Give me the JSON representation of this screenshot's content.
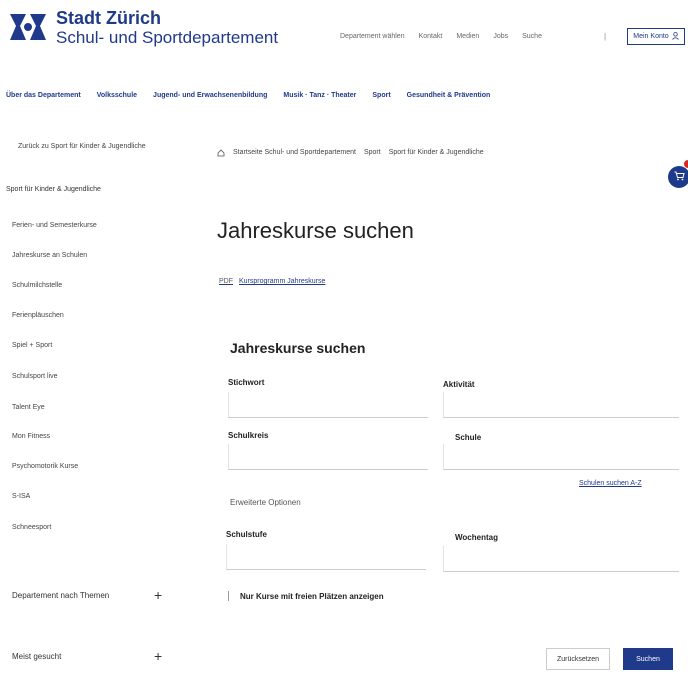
{
  "header": {
    "brand_title": "Stadt Zürich",
    "brand_sub": "Schul- und Sportdepartement",
    "service_links": [
      "Departement wählen",
      "Kontakt",
      "Medien",
      "Jobs",
      "Suche"
    ],
    "lang_separator": "|",
    "account_label": "Mein Konto",
    "account_icon": "user-icon"
  },
  "main_nav": [
    "Über das Departement",
    "Volksschule",
    "Jugend- und Erwachsenenbildung",
    "Musik · Tanz · Theater",
    "Sport",
    "Gesundheit & Prävention"
  ],
  "back_link": "Zurück zu Sport für Kinder & Jugendliche",
  "breadcrumb": [
    "Startseite Schul- und Sportdepartement",
    "Sport",
    "Sport für Kinder & Jugendliche"
  ],
  "breadcrumb_icon": "home-icon",
  "sidebar": {
    "title": "Sport für Kinder & Jugendliche",
    "items": [
      "Ferien- und Semesterkurse",
      "Jahreskurse an Schulen",
      "Schulmilchstelle",
      "Ferienpläuschen",
      "Spiel + Sport",
      "Schulsport live",
      "Talent Eye",
      "Mon Fitness",
      "Psychomotorik Kurse",
      "S-ISA",
      "Schneesport"
    ],
    "accordions": [
      "Departement nach Themen",
      "Meist gesucht"
    ]
  },
  "content": {
    "page_title": "Jahreskurse suchen",
    "doc_link_page": "PDF",
    "doc_link_label": "Kursprogramm Jahreskurse",
    "form_title": "Jahreskurse suchen",
    "fields": {
      "stichwort": "Stichwort",
      "aktivitaet": "Aktivität",
      "schulkreis": "Schulkreis",
      "schule": "Schule",
      "schulstufe": "Schulstufe",
      "wochentag": "Wochentag"
    },
    "school_link": "Schulen suchen A-Z",
    "extended_options": "Erweiterte Optionen",
    "checkbox_label": "Nur Kurse mit freien Plätzen anzeigen",
    "reset_label": "Zurücksetzen",
    "search_label": "Suchen"
  },
  "colors": {
    "brand": "#1f3a8a",
    "cart_badge": "#d9281f"
  }
}
